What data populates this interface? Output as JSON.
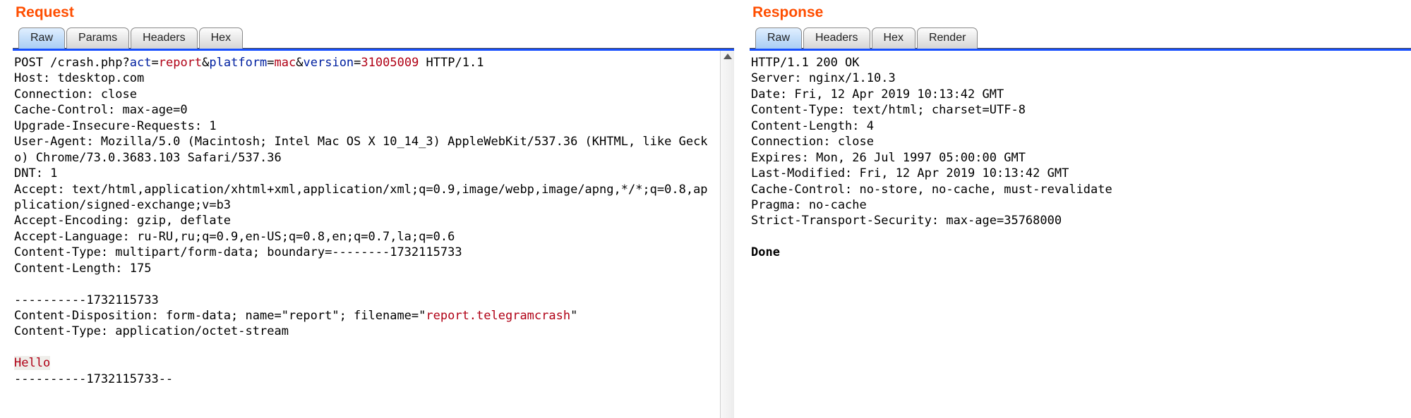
{
  "titles": {
    "request": "Request",
    "response": "Response"
  },
  "tabs": {
    "request": [
      "Raw",
      "Params",
      "Headers",
      "Hex"
    ],
    "response": [
      "Raw",
      "Headers",
      "Hex",
      "Render"
    ],
    "active_request": 0,
    "active_response": 0
  },
  "request": {
    "method": "POST",
    "path": "/crash.php",
    "http_version": "HTTP/1.1",
    "query": [
      {
        "k": "act",
        "v": "report"
      },
      {
        "k": "platform",
        "v": "mac"
      },
      {
        "k": "version",
        "v": "31005009"
      }
    ],
    "headers": {
      "Host": "tdesktop.com",
      "Connection": "close",
      "Cache-Control": "max-age=0",
      "Upgrade-Insecure-Requests": "1",
      "User-Agent": "Mozilla/5.0 (Macintosh; Intel Mac OS X 10_14_3) AppleWebKit/537.36 (KHTML, like Gecko) Chrome/73.0.3683.103 Safari/537.36",
      "DNT": "1",
      "Accept": "text/html,application/xhtml+xml,application/xml;q=0.9,image/webp,image/apng,*/*;q=0.8,application/signed-exchange;v=b3",
      "Accept-Encoding": "gzip, deflate",
      "Accept-Language": "ru-RU,ru;q=0.9,en-US;q=0.8,en;q=0.7,la;q=0.6",
      "Content-Type": "multipart/form-data; boundary=--------1732115733",
      "Content-Length": "175"
    },
    "boundary": "----------1732115733",
    "part_headers": {
      "Content-Disposition": "form-data; name=\"report\"; filename=\"",
      "filename_highlight": "report.telegramcrash",
      "filename_tail": "\"",
      "Content-Type": "application/octet-stream"
    },
    "part_body": "Hello",
    "closing_boundary": "----------1732115733--"
  },
  "response": {
    "status_line": "HTTP/1.1 200 OK",
    "headers": {
      "Server": "nginx/1.10.3",
      "Date": "Fri, 12 Apr 2019 10:13:42 GMT",
      "Content-Type": "text/html; charset=UTF-8",
      "Content-Length": "4",
      "Connection": "close",
      "Expires": "Mon, 26 Jul 1997 05:00:00 GMT",
      "Last-Modified": "Fri, 12 Apr 2019 10:13:42 GMT",
      "Cache-Control": "no-store, no-cache, must-revalidate",
      "Pragma": "no-cache",
      "Strict-Transport-Security": "max-age=35768000"
    },
    "body": "Done"
  }
}
